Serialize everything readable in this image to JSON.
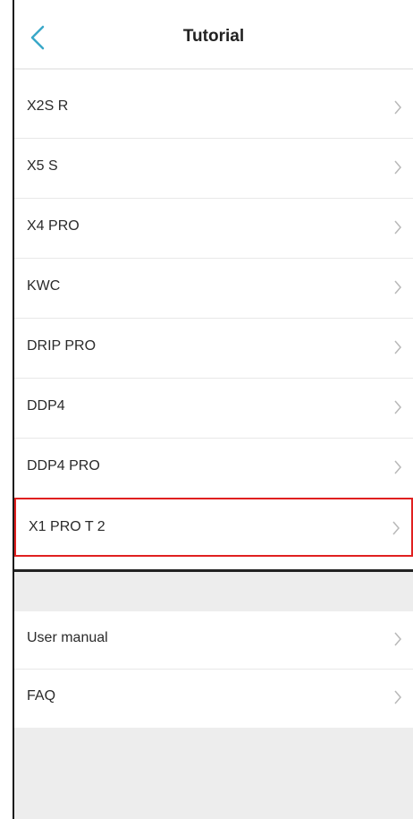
{
  "header": {
    "title": "Tutorial",
    "back_icon": "chevron-left-icon"
  },
  "tutorial_list": {
    "items": [
      {
        "label": "X2S R"
      },
      {
        "label": "X5 S"
      },
      {
        "label": "X4 PRO"
      },
      {
        "label": "KWC"
      },
      {
        "label": "DRIP PRO"
      },
      {
        "label": "DDP4"
      },
      {
        "label": "DDP4 PRO"
      },
      {
        "label": "X1 PRO T 2",
        "highlighted": true
      }
    ]
  },
  "support_list": {
    "items": [
      {
        "label": "User manual"
      },
      {
        "label": "FAQ"
      }
    ]
  },
  "colors": {
    "accent_back": "#3aa8c8",
    "highlight_border": "#e02020",
    "chevron": "#b8b8b8",
    "section_background": "#ededed"
  }
}
